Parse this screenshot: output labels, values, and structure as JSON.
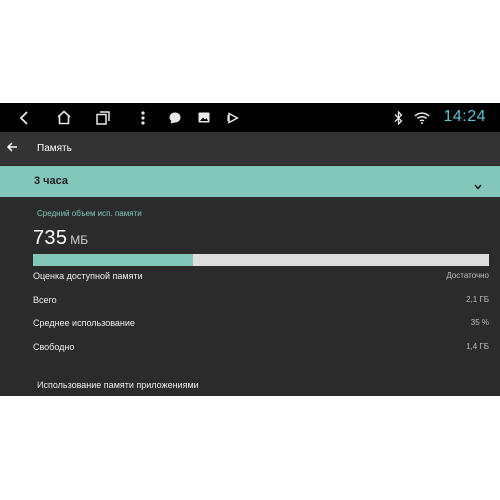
{
  "status_bar": {
    "time": "14:24",
    "icons": [
      "back-icon",
      "home-icon",
      "recent-apps-icon",
      "menu-dots-icon",
      "chat-icon",
      "image-icon",
      "play-icon",
      "bluetooth-icon",
      "wifi-icon"
    ]
  },
  "app_bar": {
    "title": "Память"
  },
  "period": {
    "selected": "3 часа"
  },
  "memory": {
    "avg_label": "Средний объем исп. памяти",
    "value": "735",
    "unit": "МБ",
    "usage_fraction": 0.35
  },
  "stats": [
    {
      "label": "Оценка доступной памяти",
      "value": "Достаточно"
    },
    {
      "label": "Всего",
      "value": "2,1 ГБ"
    },
    {
      "label": "Среднее использование",
      "value": "35 %"
    },
    {
      "label": "Свободно",
      "value": "1,4 ГБ"
    }
  ],
  "section_title": "Использование памяти приложениями",
  "colors": {
    "accent": "#82c7b9",
    "clock": "#5bc4d6",
    "background": "#2b2b2b"
  }
}
